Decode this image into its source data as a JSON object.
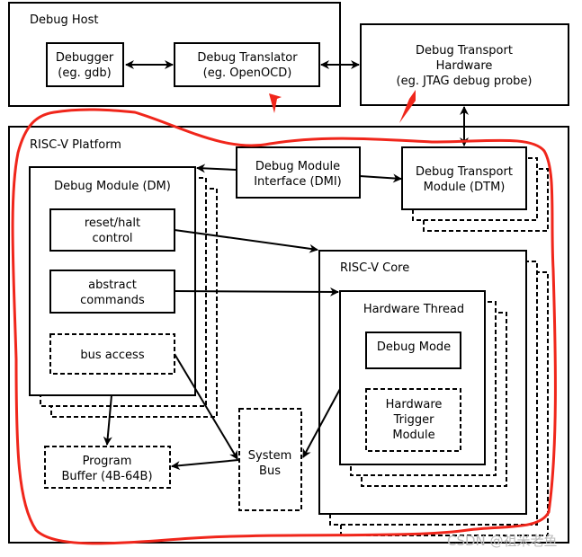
{
  "debug_host": {
    "label": "Debug Host"
  },
  "debugger": {
    "lines": [
      "Debugger",
      "(eg. gdb)"
    ]
  },
  "debug_translator": {
    "lines": [
      "Debug Translator",
      "(eg. OpenOCD)"
    ]
  },
  "debug_transport_hardware": {
    "lines": [
      "Debug Transport",
      "Hardware",
      "(eg. JTAG debug probe)"
    ]
  },
  "platform": {
    "label": "RISC-V Platform"
  },
  "dmi": {
    "lines": [
      "Debug Module",
      "Interface (DMI)"
    ]
  },
  "dtm": {
    "lines": [
      "Debug Transport",
      "Module (DTM)"
    ]
  },
  "debug_module": {
    "label": "Debug Module (DM)"
  },
  "reset_halt": {
    "lines": [
      "reset/halt",
      "control"
    ]
  },
  "abstract_commands": {
    "lines": [
      "abstract",
      "commands"
    ]
  },
  "bus_access": {
    "label": "bus access"
  },
  "program_buffer": {
    "lines": [
      "Program",
      "Buffer (4B-64B)"
    ]
  },
  "system_bus": {
    "lines": [
      "System",
      "Bus"
    ]
  },
  "core": {
    "label": "RISC-V Core"
  },
  "hardware_thread": {
    "label": "Hardware Thread"
  },
  "debug_mode": {
    "label": "Debug Mode"
  },
  "trigger_module": {
    "lines": [
      "Hardware",
      "Trigger",
      "Module"
    ]
  },
  "watermark": "CSDN @祖米老鱼",
  "colors": {
    "annotation": "#f0261b",
    "stroke": "#000000"
  }
}
